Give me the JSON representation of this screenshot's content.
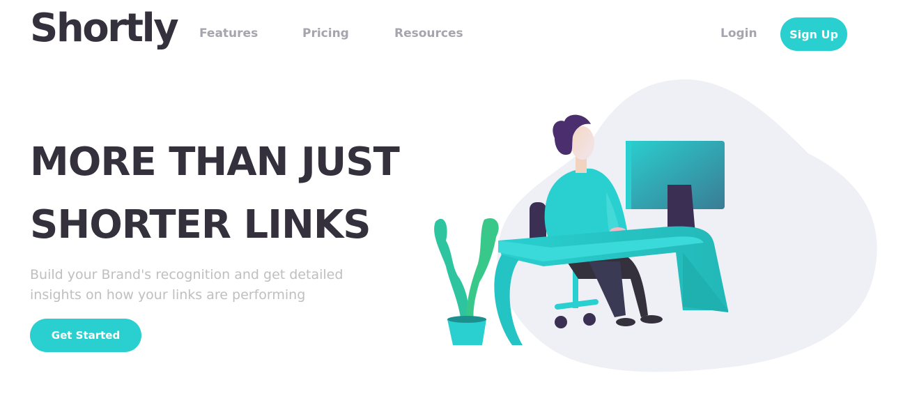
{
  "header": {
    "logo": "Shortly",
    "nav": {
      "features": "Features",
      "pricing": "Pricing",
      "resources": "Resources"
    },
    "login": "Login",
    "signup": "Sign Up"
  },
  "hero": {
    "title_line1": "MORE THAN JUST",
    "title_line2": "SHORTER LINKS",
    "subtitle": "Build your Brand's recognition and get detailed insights on how your links are performing",
    "cta": "Get Started"
  },
  "colors": {
    "accent": "#2acfcf",
    "dark": "#34313d",
    "muted": "#bfbfbf",
    "blob": "#eff0f5",
    "plant": "#2ec4a0"
  },
  "illustration": {
    "name": "person-working-at-desk-illustration"
  }
}
